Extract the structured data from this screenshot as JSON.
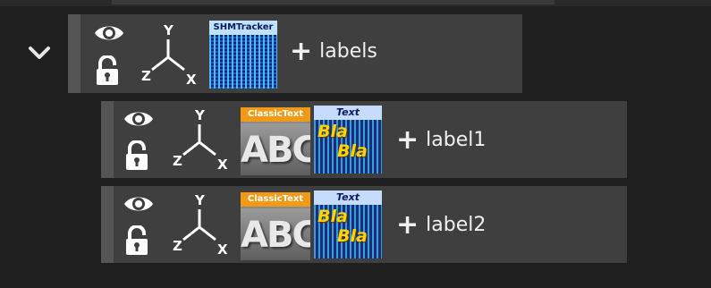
{
  "tree": {
    "root": {
      "name": "labels",
      "tracker_tag": "SHMTracker",
      "axes": {
        "x": "X",
        "y": "Y",
        "z": "Z"
      },
      "icons": [
        "eye-icon",
        "unlock-icon",
        "axes-icon",
        "shm-tracker-icon"
      ]
    },
    "children": [
      {
        "name": "label1",
        "classic_tag": "ClassicText",
        "classic_preview": "ABC",
        "text_tag": "Text",
        "text_preview_a": "Bla",
        "text_preview_b": "Bla",
        "axes": {
          "x": "X",
          "y": "Y",
          "z": "Z"
        }
      },
      {
        "name": "label2",
        "classic_tag": "ClassicText",
        "classic_preview": "ABC",
        "text_tag": "Text",
        "text_preview_a": "Bla",
        "text_preview_b": "Bla",
        "axes": {
          "x": "X",
          "y": "Y",
          "z": "Z"
        }
      }
    ],
    "add_symbol": "+"
  },
  "colors": {
    "background": "#1f1f1f",
    "row": "#3f3f3f",
    "handle": "#555555",
    "classic_tag": "#f29a16",
    "text_yellow": "#ffd400"
  }
}
